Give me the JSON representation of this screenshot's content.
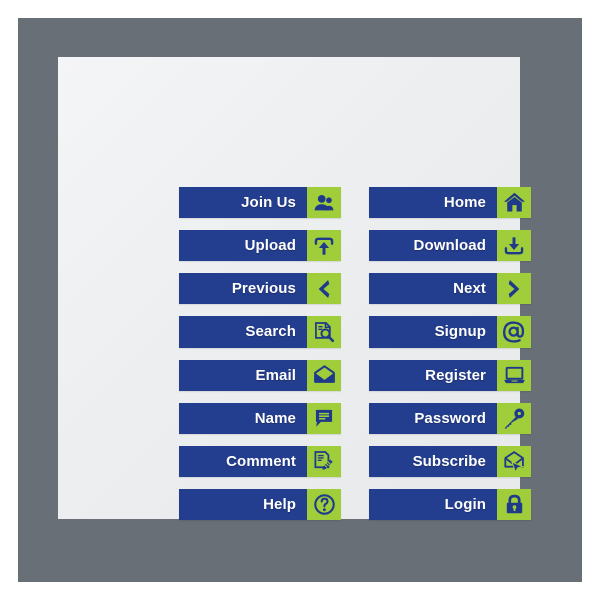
{
  "frame": {
    "outer_background": "#ffffff",
    "border_color": "#696f76",
    "panel_color": "#ebecee"
  },
  "theme": {
    "button_blue": "#243e8f",
    "icon_green": "#a0ce3a",
    "label_text_color": "#ffffff",
    "icon_glyph_color": "#1f3a8a"
  },
  "buttons": {
    "left_column": [
      {
        "label": "Join Us",
        "icon": "users-icon"
      },
      {
        "label": "Upload",
        "icon": "upload-arrow-icon"
      },
      {
        "label": "Previous",
        "icon": "chevron-left-icon"
      },
      {
        "label": "Search",
        "icon": "document-magnifier-icon"
      },
      {
        "label": "Email",
        "icon": "envelope-icon"
      },
      {
        "label": "Name",
        "icon": "speech-bubble-icon"
      },
      {
        "label": "Comment",
        "icon": "document-pen-icon"
      },
      {
        "label": "Help",
        "icon": "question-mark-circle-icon"
      }
    ],
    "right_column": [
      {
        "label": "Home",
        "icon": "house-icon"
      },
      {
        "label": "Download",
        "icon": "download-arrow-icon"
      },
      {
        "label": "Next",
        "icon": "chevron-right-icon"
      },
      {
        "label": "Signup",
        "icon": "at-sign-icon"
      },
      {
        "label": "Register",
        "icon": "laptop-icon"
      },
      {
        "label": "Password",
        "icon": "key-icon"
      },
      {
        "label": "Subscribe",
        "icon": "envelope-cursor-icon"
      },
      {
        "label": "Login",
        "icon": "padlock-icon"
      }
    ]
  }
}
